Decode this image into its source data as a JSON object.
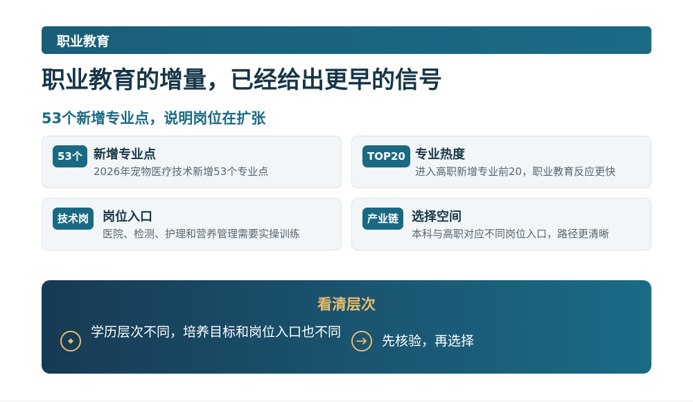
{
  "banner": {
    "label": "职业教育"
  },
  "title": "职业教育的增量，已经给出更早的信号",
  "subtitle": "53个新增专业点，说明岗位在扩张",
  "cards": [
    {
      "badge": "53个",
      "title": "新增专业点",
      "desc": "2026年宠物医疗技术新增53个专业点"
    },
    {
      "badge": "TOP20",
      "title": "专业热度",
      "desc": "进入高职新增专业前20，职业教育反应更快"
    },
    {
      "badge": "技术岗",
      "title": "岗位入口",
      "desc": "医院、检测、护理和营养管理需要实操训练"
    },
    {
      "badge": "产业链",
      "title": "选择空间",
      "desc": "本科与高职对应不同岗位入口，路径更清晰"
    }
  ],
  "panel": {
    "title": "看清层次",
    "items": [
      {
        "icon": "diamond-icon",
        "text": "学历层次不同，培养目标和岗位入口也不同"
      },
      {
        "icon": "arrow-right-icon",
        "text": "先核验，再选择"
      }
    ]
  },
  "colors": {
    "banner": "#1a6983",
    "title": "#173647",
    "accent": "#1a6983",
    "gold": "#e9bd6d",
    "card_bg": "#f2f6f9",
    "panel_start": "#173a54",
    "panel_end": "#1a6b86"
  }
}
